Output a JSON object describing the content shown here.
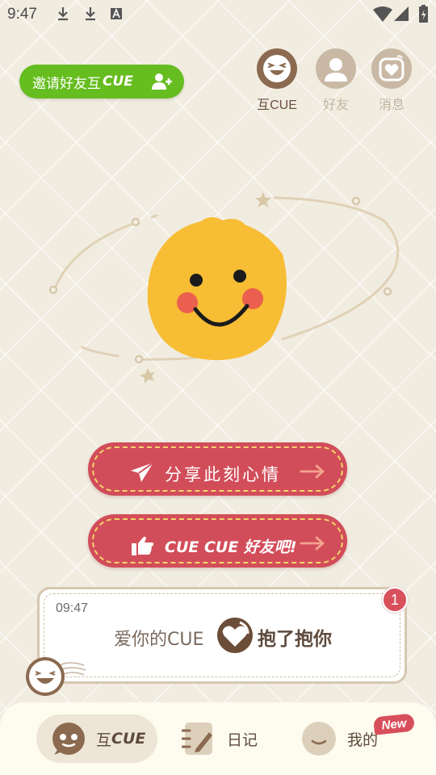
{
  "status_bar": {
    "time": "9:47"
  },
  "invite": {
    "label": "邀请好友互",
    "cue": "CUE"
  },
  "top_tabs": [
    {
      "label": "互CUE",
      "active": true
    },
    {
      "label": "好友",
      "active": false
    },
    {
      "label": "消息",
      "active": false
    }
  ],
  "actions": {
    "share": {
      "label": "分享此刻心情"
    },
    "cue_friend": {
      "label": "CUE CUE 好友吧!"
    }
  },
  "cue_card": {
    "time": "09:47",
    "message": "爱你的CUE",
    "action": "抱了抱你",
    "badge": "1"
  },
  "bottom_nav": [
    {
      "label": "互",
      "cue": "CUE",
      "active": true
    },
    {
      "label": "日记",
      "active": false
    },
    {
      "label": "我的",
      "active": false,
      "badge": "New"
    }
  ],
  "colors": {
    "background": "#f1ece0",
    "invite_green": "#66bd1f",
    "brand_brown": "#8b6a4f",
    "button_red": "#d24d5a",
    "dash_yellow": "#f5d36a",
    "smiley_yellow": "#f7bd34"
  }
}
